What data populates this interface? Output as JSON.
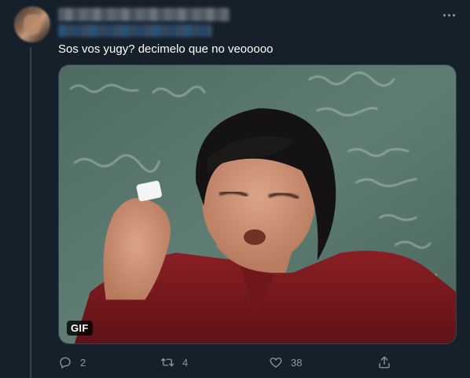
{
  "tweet": {
    "text": "Sos vos yugy? decimelo que no veooooo",
    "media": {
      "badge": "GIF"
    },
    "actions": {
      "reply": {
        "icon": "reply-icon",
        "count": "2"
      },
      "retweet": {
        "icon": "retweet-icon",
        "count": "4"
      },
      "like": {
        "icon": "heart-icon",
        "count": "38"
      },
      "share": {
        "icon": "share-icon"
      }
    }
  },
  "colors": {
    "background": "#15202b",
    "text": "#ffffff",
    "secondary": "#8899a6",
    "border": "#38444d"
  }
}
